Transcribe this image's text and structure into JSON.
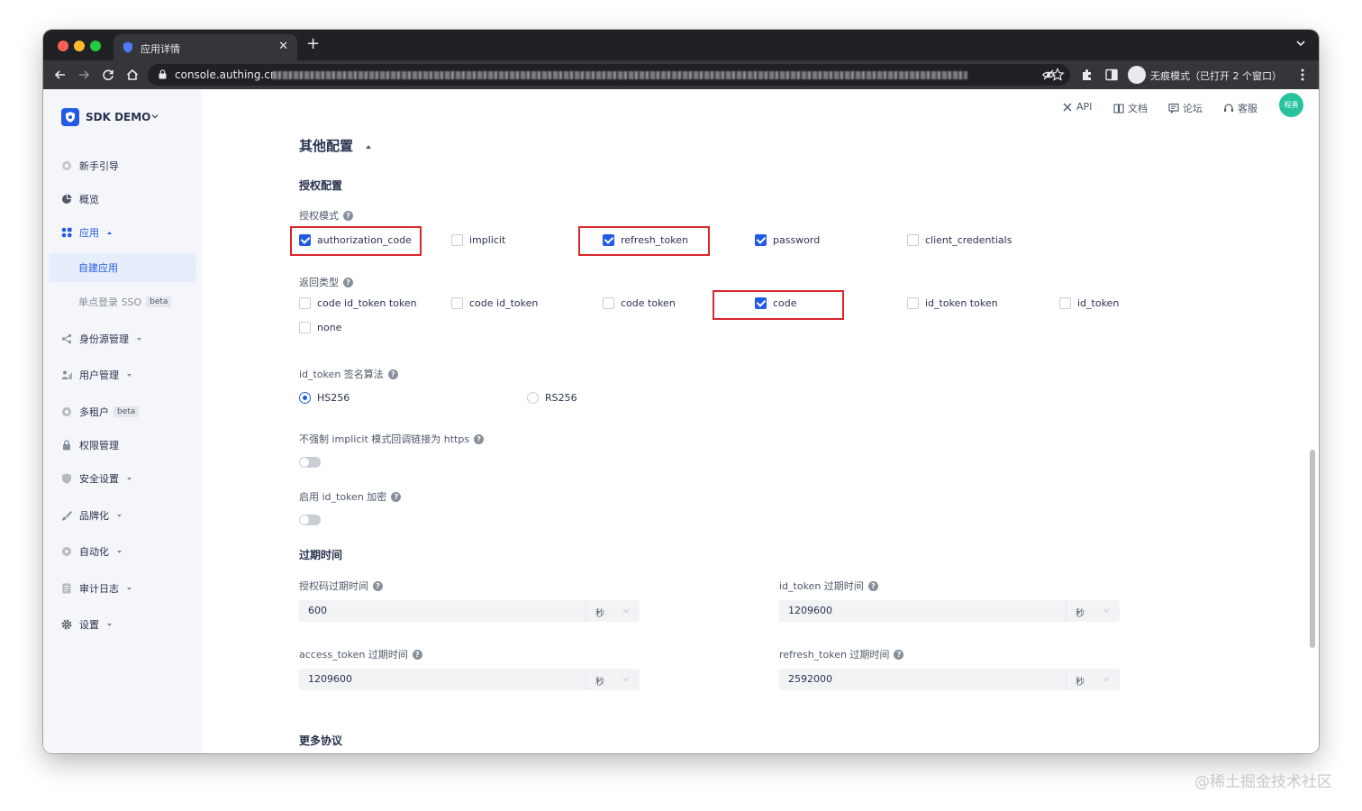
{
  "browser": {
    "tab_title": "应用详情",
    "url_host": "console.authing.cn",
    "incognito_label": "无痕模式（已打开 2 个窗口）"
  },
  "sidebar": {
    "app_name": "SDK DEMO",
    "items": [
      {
        "label": "新手引导",
        "icon": "guide-icon"
      },
      {
        "label": "概览",
        "icon": "pie-chart-icon"
      },
      {
        "label": "应用",
        "icon": "apps-icon",
        "expanded": true
      },
      {
        "label": "身份源管理",
        "icon": "share-icon"
      },
      {
        "label": "用户管理",
        "icon": "users-icon"
      },
      {
        "label": "多租户",
        "icon": "tenant-icon",
        "badge": "beta"
      },
      {
        "label": "权限管理",
        "icon": "lock-icon"
      },
      {
        "label": "安全设置",
        "icon": "shield-icon"
      },
      {
        "label": "品牌化",
        "icon": "brush-icon"
      },
      {
        "label": "自动化",
        "icon": "automation-icon"
      },
      {
        "label": "审计日志",
        "icon": "log-icon"
      },
      {
        "label": "设置",
        "icon": "gear-icon"
      }
    ],
    "sub_items": [
      {
        "label": "自建应用",
        "active": true
      },
      {
        "label": "单点登录 SSO",
        "badge": "beta"
      }
    ]
  },
  "topbar": {
    "links": [
      {
        "label": "API",
        "icon": "api-icon"
      },
      {
        "label": "文档",
        "icon": "book-icon"
      },
      {
        "label": "论坛",
        "icon": "forum-icon"
      },
      {
        "label": "客服",
        "icon": "headset-icon"
      }
    ],
    "avatar_text": "程勇"
  },
  "main": {
    "section_title": "其他配置",
    "auth_config": {
      "title": "授权配置",
      "grant_label": "授权模式",
      "grant_types": [
        {
          "label": "authorization_code",
          "checked": true,
          "highlighted": true
        },
        {
          "label": "implicit",
          "checked": false
        },
        {
          "label": "refresh_token",
          "checked": true,
          "highlighted": true
        },
        {
          "label": "password",
          "checked": true
        },
        {
          "label": "client_credentials",
          "checked": false
        }
      ],
      "response_label": "返回类型",
      "response_types": [
        {
          "label": "code id_token token",
          "checked": false
        },
        {
          "label": "code id_token",
          "checked": false
        },
        {
          "label": "code token",
          "checked": false
        },
        {
          "label": "code",
          "checked": true,
          "highlighted": true
        },
        {
          "label": "id_token token",
          "checked": false
        },
        {
          "label": "id_token",
          "checked": false
        },
        {
          "label": "none",
          "checked": false
        }
      ],
      "sign_alg_label": "id_token 签名算法",
      "sign_algs": [
        {
          "label": "HS256",
          "selected": true
        },
        {
          "label": "RS256",
          "selected": false
        }
      ],
      "implicit_https_label": "不强制 implicit 模式回调链接为 https",
      "implicit_https_on": false,
      "id_token_encrypt_label": "启用 id_token 加密",
      "id_token_encrypt_on": false
    },
    "expiry": {
      "title": "过期时间",
      "fields": [
        {
          "label": "授权码过期时间",
          "value": "600",
          "unit": "秒"
        },
        {
          "label": "id_token 过期时间",
          "value": "1209600",
          "unit": "秒"
        },
        {
          "label": "access_token 过期时间",
          "value": "1209600",
          "unit": "秒"
        },
        {
          "label": "refresh_token 过期时间",
          "value": "2592000",
          "unit": "秒"
        }
      ]
    },
    "more_protocols_title": "更多协议"
  },
  "watermark": "@稀土掘金技术社区",
  "colors": {
    "accent": "#215ae5",
    "highlight": "#d9262b",
    "avatar": "#27c3a0"
  }
}
